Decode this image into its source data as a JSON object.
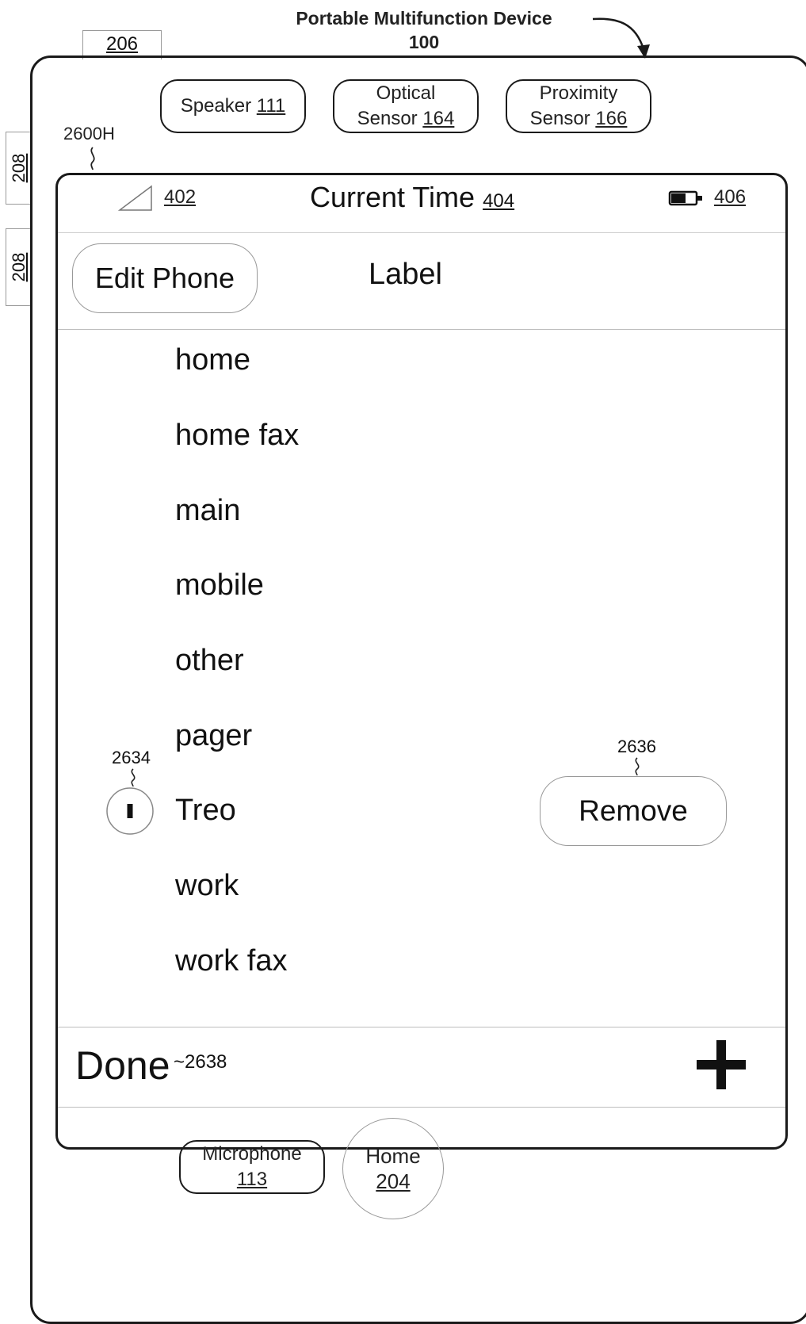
{
  "figure": {
    "title_line1": "Portable Multifunction Device",
    "title_line2": "100",
    "ref_206": "206",
    "ref_208_top": "208",
    "ref_208_bottom": "208",
    "ref_2600H": "2600H",
    "ref_2634": "2634",
    "ref_2636": "2636",
    "ref_2638": "2638"
  },
  "hardware": {
    "speaker_label": "Speaker",
    "speaker_ref": "111",
    "optical_label": "Optical",
    "optical_label2": "Sensor",
    "optical_ref": "164",
    "proximity_label": "Proximity",
    "proximity_label2": "Sensor",
    "proximity_ref": "166",
    "microphone_label": "Microphone",
    "microphone_ref": "113",
    "home_label": "Home",
    "home_ref": "204"
  },
  "status_bar": {
    "signal_ref": "402",
    "time_label": "Current Time",
    "time_ref": "404",
    "battery_ref": "406"
  },
  "nav": {
    "edit_phone_label": "Edit Phone",
    "title": "Label"
  },
  "labels": [
    "home",
    "home fax",
    "main",
    "mobile",
    "other",
    "pager",
    "Treo",
    "work",
    "work fax"
  ],
  "row_actions": {
    "remove_label": "Remove"
  },
  "toolbar": {
    "done_label": "Done",
    "add_icon": "plus-icon"
  }
}
